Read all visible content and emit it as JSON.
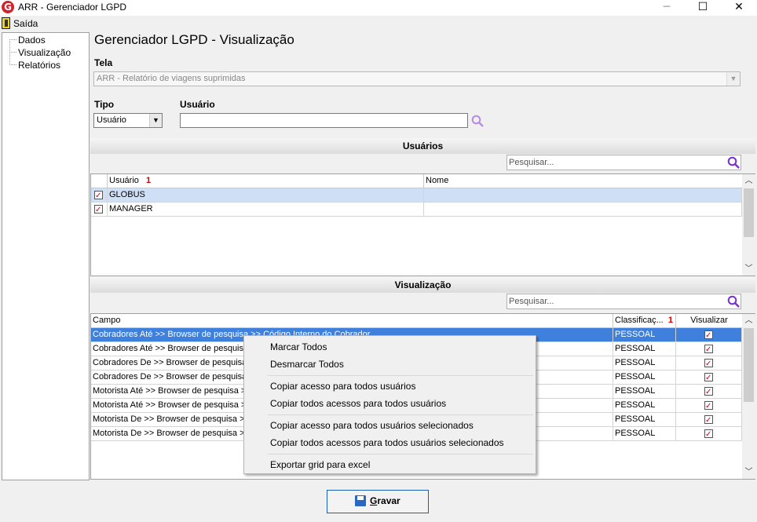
{
  "window": {
    "title": "ARR - Gerenciador LGPD",
    "logo": "G"
  },
  "menu": {
    "exit_label": "Saída"
  },
  "tree": {
    "items": [
      "Dados",
      "Visualização",
      "Relatórios"
    ]
  },
  "page": {
    "title": "Gerenciador LGPD - Visualização"
  },
  "form": {
    "tela_label": "Tela",
    "tela_value": "ARR - Relatório de viagens suprimidas",
    "tipo_label": "Tipo",
    "tipo_value": "Usuário",
    "usuario_label": "Usuário",
    "usuario_value": ""
  },
  "users": {
    "section_title": "Usuários",
    "search_placeholder": "Pesquisar...",
    "columns": [
      "Usuário",
      "Nome"
    ],
    "sort_indicator": "1",
    "rows": [
      {
        "usuario": "GLOBUS",
        "nome": "",
        "checked": true,
        "selected": true
      },
      {
        "usuario": "MANAGER",
        "nome": "",
        "checked": true,
        "selected": false
      }
    ]
  },
  "visualizacao": {
    "section_title": "Visualização",
    "search_placeholder": "Pesquisar...",
    "columns": [
      "Campo",
      "Classificaç...",
      "Visualizar"
    ],
    "sort_indicator": "1",
    "rows": [
      {
        "campo": "Cobradores Até >> Browser de pesquisa >> Código Interno do Cobrador",
        "classificacao": "PESSOAL",
        "visualizar": true,
        "selected": true
      },
      {
        "campo": "Cobradores Até >> Browser de pesquisa",
        "classificacao": "PESSOAL",
        "visualizar": true,
        "selected": false
      },
      {
        "campo": "Cobradores De >> Browser de pesquisa",
        "classificacao": "PESSOAL",
        "visualizar": true,
        "selected": false
      },
      {
        "campo": "Cobradores De >> Browser de pesquisa",
        "classificacao": "PESSOAL",
        "visualizar": true,
        "selected": false
      },
      {
        "campo": "Motorista Até >> Browser de pesquisa >>",
        "classificacao": "PESSOAL",
        "visualizar": true,
        "selected": false
      },
      {
        "campo": "Motorista Até >> Browser de pesquisa >>",
        "classificacao": "PESSOAL",
        "visualizar": true,
        "selected": false
      },
      {
        "campo": "Motorista De >> Browser de pesquisa >>",
        "classificacao": "PESSOAL",
        "visualizar": true,
        "selected": false
      },
      {
        "campo": "Motorista De >> Browser de pesquisa >>",
        "classificacao": "PESSOAL",
        "visualizar": true,
        "selected": false
      }
    ]
  },
  "context_menu": {
    "items": [
      "Marcar Todos",
      "Desmarcar Todos",
      "Copiar acesso para todos usuários",
      "Copiar todos acessos para todos usuários",
      "Copiar acesso para todos usuários selecionados",
      "Copiar todos acessos para todos usuários selecionados",
      "Exportar grid para excel"
    ]
  },
  "footer": {
    "save_label_first": "G",
    "save_label_rest": "ravar"
  },
  "colors": {
    "selection": "#3f80dc",
    "selection_light": "#cfe0f6",
    "check": "#d0021b",
    "search_icon": "#7b2ed1"
  }
}
